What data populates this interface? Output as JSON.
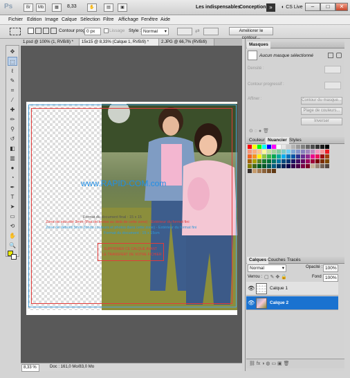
{
  "app": {
    "logo": "Ps",
    "zoom": "8,33",
    "workspace_1": "Les indispensables",
    "workspace_2": "Conception",
    "cs_live": "CS Live"
  },
  "menus": [
    "Fichier",
    "Edition",
    "Image",
    "Calque",
    "Sélection",
    "Filtre",
    "Affichage",
    "Fenêtre",
    "Aide"
  ],
  "options": {
    "contour_label": "Contour progr.",
    "contour_value": "0 px",
    "lissage_label": "Lissage",
    "style_label": "Style :",
    "style_value": "Normal",
    "ameliorer": "Améliorer le contour..."
  },
  "tabs": [
    "1.psd @ 100% (1, RVB/8) *",
    "15x15 @ 8,33% (Calque 1, RVB/8) *",
    "2.JPG @ 66,7% (RVB/8)"
  ],
  "canvas": {
    "watermark": "www.RAPID-COM.com",
    "format_note": "Format du document final : 15 x 15",
    "zone_securite": "Zone de sécurité 3mm (Pas de textes au delà de cette zone) - Extérieur du format fini",
    "zone_debord": "Zone de débord 5mm (fonds couleurs et photos dans cette zone) - Extérieur du format fini",
    "zone_debord_2": "Format du document : 15 x 15cm",
    "stamp_1": "SUPPRIMER CE CALQUE AVANT",
    "stamp_2": "LE TRANSFERT DE VOTRE FICHIER"
  },
  "status": {
    "zoom": "8,33 %",
    "doc": "Doc : 161,0 Mo/83,0 Mo"
  },
  "masques": {
    "tab": "Masques",
    "none_selected": "Aucun masque sélectionné",
    "densite": "Densité :",
    "contour": "Contour progressif :",
    "affiner": "Affiner :",
    "btn_contour": "Contour du masque...",
    "btn_plage": "Plage de couleurs...",
    "btn_inverser": "Inverser"
  },
  "color_panel": {
    "tabs": [
      "Couleur",
      "Nuancier",
      "Styles"
    ],
    "swatches": [
      "#ff0000",
      "#ffff00",
      "#00ff00",
      "#00ffff",
      "#0000ff",
      "#ff00ff",
      "#ffffff",
      "#e6e6e6",
      "#cccccc",
      "#b3b3b3",
      "#999999",
      "#808080",
      "#666666",
      "#4d4d4d",
      "#333333",
      "#1a1a1a",
      "#000000",
      "#f7977a",
      "#f9ad81",
      "#fdc68a",
      "#fff79a",
      "#c4df9b",
      "#a2d39c",
      "#82ca9d",
      "#7bcdc8",
      "#6ecff6",
      "#7ea7d8",
      "#8493ca",
      "#8882be",
      "#a187be",
      "#bc8dbf",
      "#f49ac2",
      "#f6989d",
      "#ed1c24",
      "#f26522",
      "#f7941d",
      "#fff200",
      "#8dc73f",
      "#39b54a",
      "#00a651",
      "#00a99d",
      "#00aeef",
      "#0072bc",
      "#0054a6",
      "#2e3192",
      "#662d91",
      "#92278f",
      "#ec008c",
      "#ed145b",
      "#9e0b0f",
      "#a0410d",
      "#a36209",
      "#aba000",
      "#598527",
      "#1a7b30",
      "#007236",
      "#00746b",
      "#0076a3",
      "#004b80",
      "#003471",
      "#1b1464",
      "#440e62",
      "#630460",
      "#9e005d",
      "#9e0039",
      "#790000",
      "#7b2e00",
      "#7d4900",
      "#827b00",
      "#406618",
      "#005e20",
      "#005826",
      "#005952",
      "#005b7f",
      "#003663",
      "#002157",
      "#0d004c",
      "#32004b",
      "#4b0049",
      "#7b0046",
      "#7a0026",
      "#c7b299",
      "#998675",
      "#736357",
      "#534741",
      "#37302d",
      "#c69c6d",
      "#a67c52",
      "#8c6239",
      "#754c24",
      "#603913"
    ]
  },
  "layers": {
    "tabs": [
      "Calques",
      "Couches",
      "Tracés"
    ],
    "blend": "Normal",
    "opacity_label": "Opacité :",
    "opacity": "100%",
    "lock_label": "Verrou :",
    "fill_label": "Fond :",
    "fill": "100%",
    "items": [
      {
        "name": "Calque 1"
      },
      {
        "name": "Calque 2"
      }
    ]
  },
  "colors": {
    "accent_blue": "#2f7fd6",
    "selection_blue": "#1a72d0",
    "guide_red": "#e23b3b",
    "guide_blue": "#4aa3df",
    "foreground": "#e8e800"
  }
}
